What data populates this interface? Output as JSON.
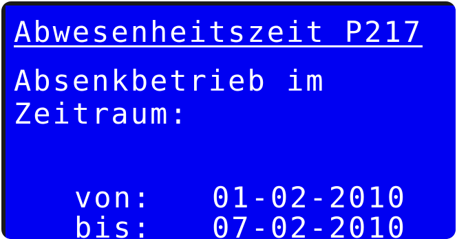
{
  "display": {
    "title": "Abwesenheitszeit P217",
    "message_line1": "Absenkbetrieb im",
    "message_line2": "Zeitraum:",
    "from_label": "von:",
    "from_value": "01-02-2010",
    "to_label": "bis:",
    "to_value": "07-02-2010"
  },
  "colors": {
    "screen_background": "#0000f2",
    "text": "#ffffff",
    "bezel": "#1a1a1a"
  }
}
